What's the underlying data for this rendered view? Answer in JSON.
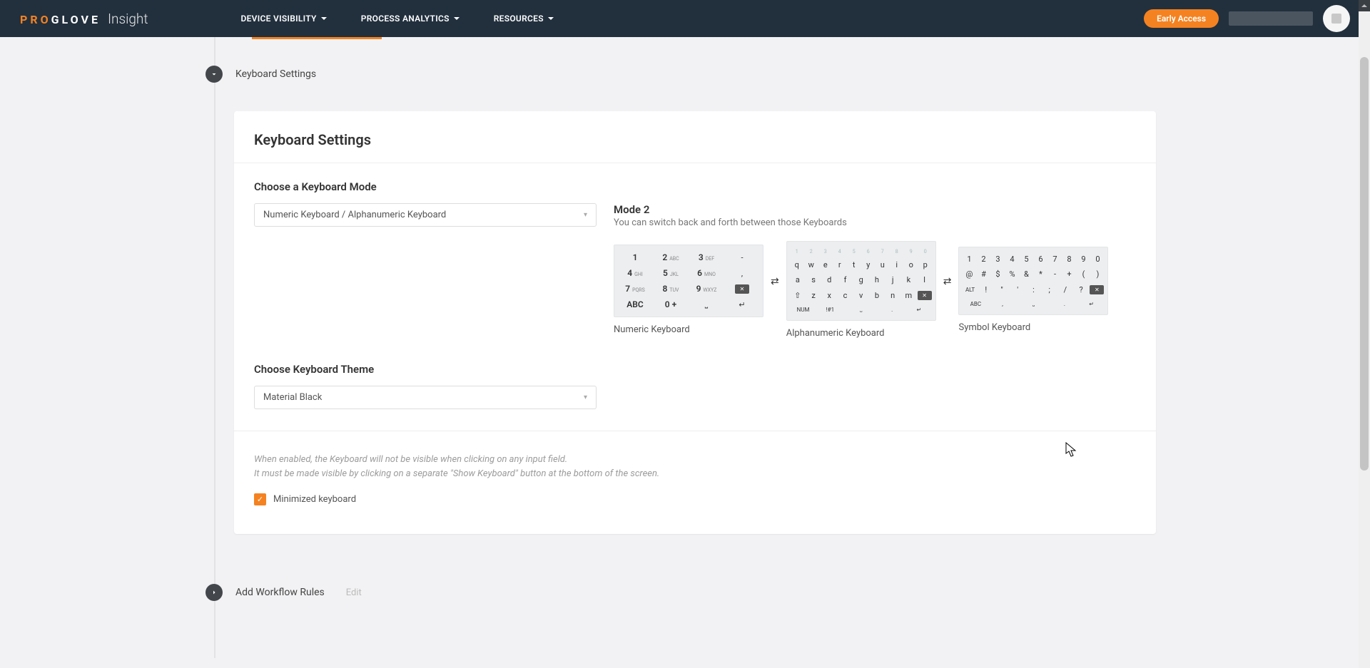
{
  "header": {
    "logo_pro": "PRO",
    "logo_glove": "GLOVE",
    "product": "Insight",
    "nav": [
      "DEVICE VISIBILITY",
      "PROCESS ANALYTICS",
      "RESOURCES"
    ],
    "early_access": "Early Access"
  },
  "sections": {
    "keyboard": {
      "title": "Keyboard Settings"
    },
    "workflow": {
      "title": "Add Workflow Rules",
      "edit": "Edit"
    }
  },
  "card": {
    "title": "Keyboard Settings",
    "mode_label": "Choose a Keyboard Mode",
    "mode_value": "Numeric Keyboard / Alphanumeric Keyboard",
    "mode_name": "Mode 2",
    "mode_desc": "You can switch back and forth between those Keyboards",
    "kb_numeric": "Numeric Keyboard",
    "kb_alpha": "Alphanumeric Keyboard",
    "kb_symbol": "Symbol Keyboard",
    "theme_label": "Choose Keyboard Theme",
    "theme_value": "Material Black",
    "note_line1": "When enabled, the Keyboard will not be visible when clicking on any input field.",
    "note_line2": "It must be made visible by clicking on a separate \"Show Keyboard\" button at the bottom of the screen.",
    "minimized_label": "Minimized keyboard"
  }
}
